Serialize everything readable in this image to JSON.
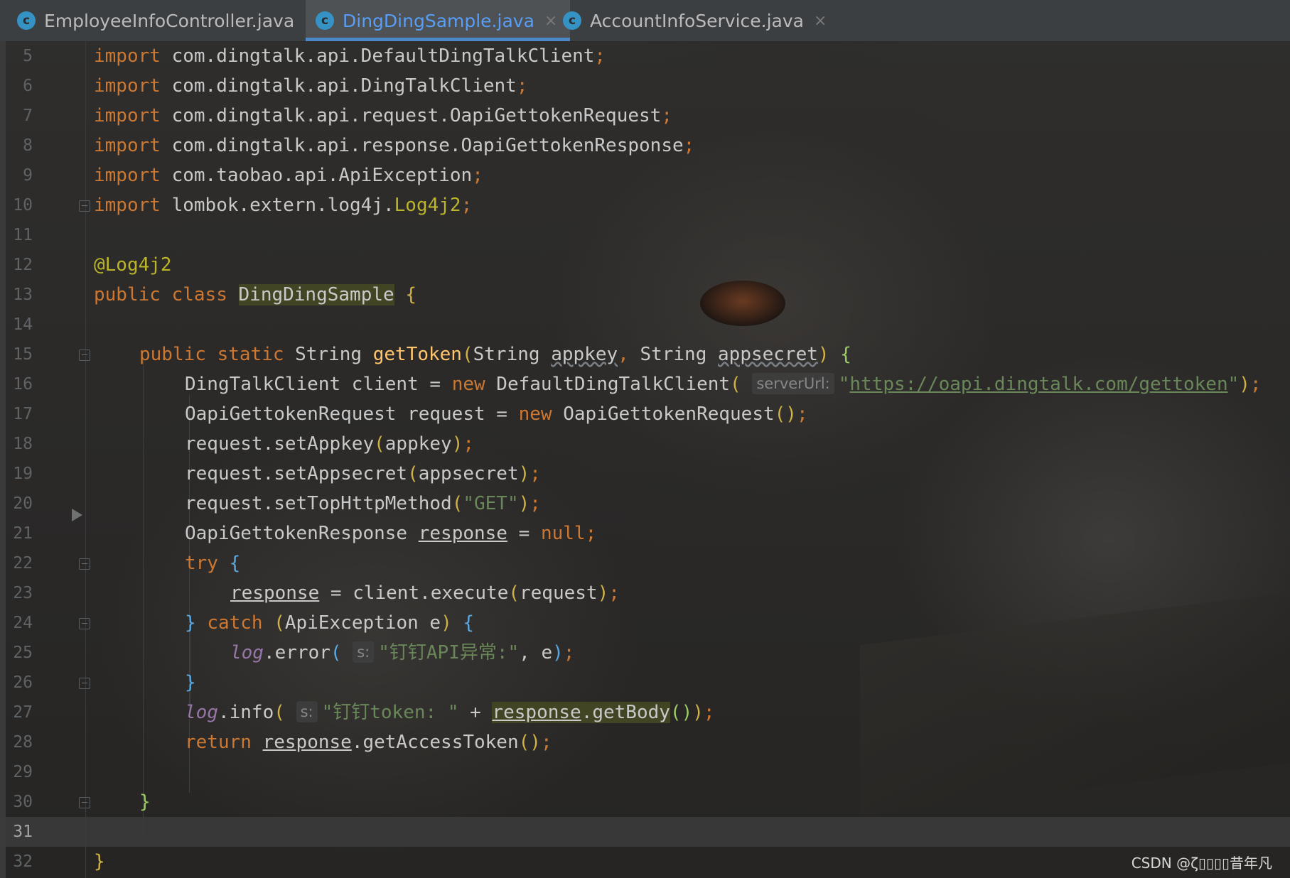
{
  "tabs": [
    {
      "label": "EmployeeInfoController.java",
      "icon": "c",
      "active": false
    },
    {
      "label": "DingDingSample.java",
      "icon": "c",
      "active": true
    },
    {
      "label": "AccountInfoService.java",
      "icon": "c",
      "active": false
    }
  ],
  "close_glyph": "×",
  "lines": [
    {
      "n": "5"
    },
    {
      "n": "6"
    },
    {
      "n": "7"
    },
    {
      "n": "8"
    },
    {
      "n": "9"
    },
    {
      "n": "10"
    },
    {
      "n": "11"
    },
    {
      "n": "12"
    },
    {
      "n": "13"
    },
    {
      "n": "14"
    },
    {
      "n": "15"
    },
    {
      "n": "16"
    },
    {
      "n": "17"
    },
    {
      "n": "18"
    },
    {
      "n": "19"
    },
    {
      "n": "20"
    },
    {
      "n": "21"
    },
    {
      "n": "22"
    },
    {
      "n": "23"
    },
    {
      "n": "24"
    },
    {
      "n": "25"
    },
    {
      "n": "26"
    },
    {
      "n": "27"
    },
    {
      "n": "28"
    },
    {
      "n": "29"
    },
    {
      "n": "30"
    },
    {
      "n": "31"
    },
    {
      "n": "32"
    }
  ],
  "code": {
    "kw_import": "import",
    "l5": " com.dingtalk.api.DefaultDingTalkClient",
    "l6": " com.dingtalk.api.DingTalkClient",
    "l7": " com.dingtalk.api.request.OapiGettokenRequest",
    "l8": " com.dingtalk.api.response.OapiGettokenResponse",
    "l9": " com.taobao.api.ApiException",
    "l10a": " lombok.extern.log4j.",
    "l10b": "Log4j2",
    "semi": ";",
    "l12": "@Log4j2",
    "kw_public": "public",
    "kw_class": "class",
    "class_name": "DingDingSample",
    "brace_open": "{",
    "brace_close": "}",
    "kw_static": "static",
    "type_string": "String",
    "method_name": "getToken",
    "param_appkey": "appkey",
    "param_appsecret": "appsecret",
    "l16a": "DingTalkClient client = ",
    "kw_new": "new",
    "l16b": " DefaultDingTalkClient",
    "hint_serverurl": "serverUrl:",
    "url": "https://oapi.dingtalk.com/gettoken",
    "l17a": "OapiGettokenRequest request = ",
    "l17b": " OapiGettokenRequest",
    "l18": "request.setAppkey",
    "l19": "request.setAppsecret",
    "l20": "request.setTopHttpMethod",
    "str_get": "\"GET\"",
    "l21a": "OapiGettokenResponse ",
    "var_response": "response",
    "l21b": " = ",
    "kw_null": "null",
    "kw_try": "try",
    "l23": " = client.execute",
    "arg_request": "request",
    "kw_catch": "catch",
    "l24": "ApiException e",
    "log": "log",
    "method_error": ".error",
    "method_info": ".info",
    "hint_s": "s:",
    "str_error": "\"钉钉API异常:\"",
    "l25tail": ", e",
    "str_token": "\"钉钉token: \"",
    "plus": " + ",
    "get_body": ".getBody",
    "kw_return": "return",
    "get_access": ".getAccessToken",
    "comma": ", "
  },
  "watermark": "CSDN @ζ▯▯▯▯昔年凡"
}
